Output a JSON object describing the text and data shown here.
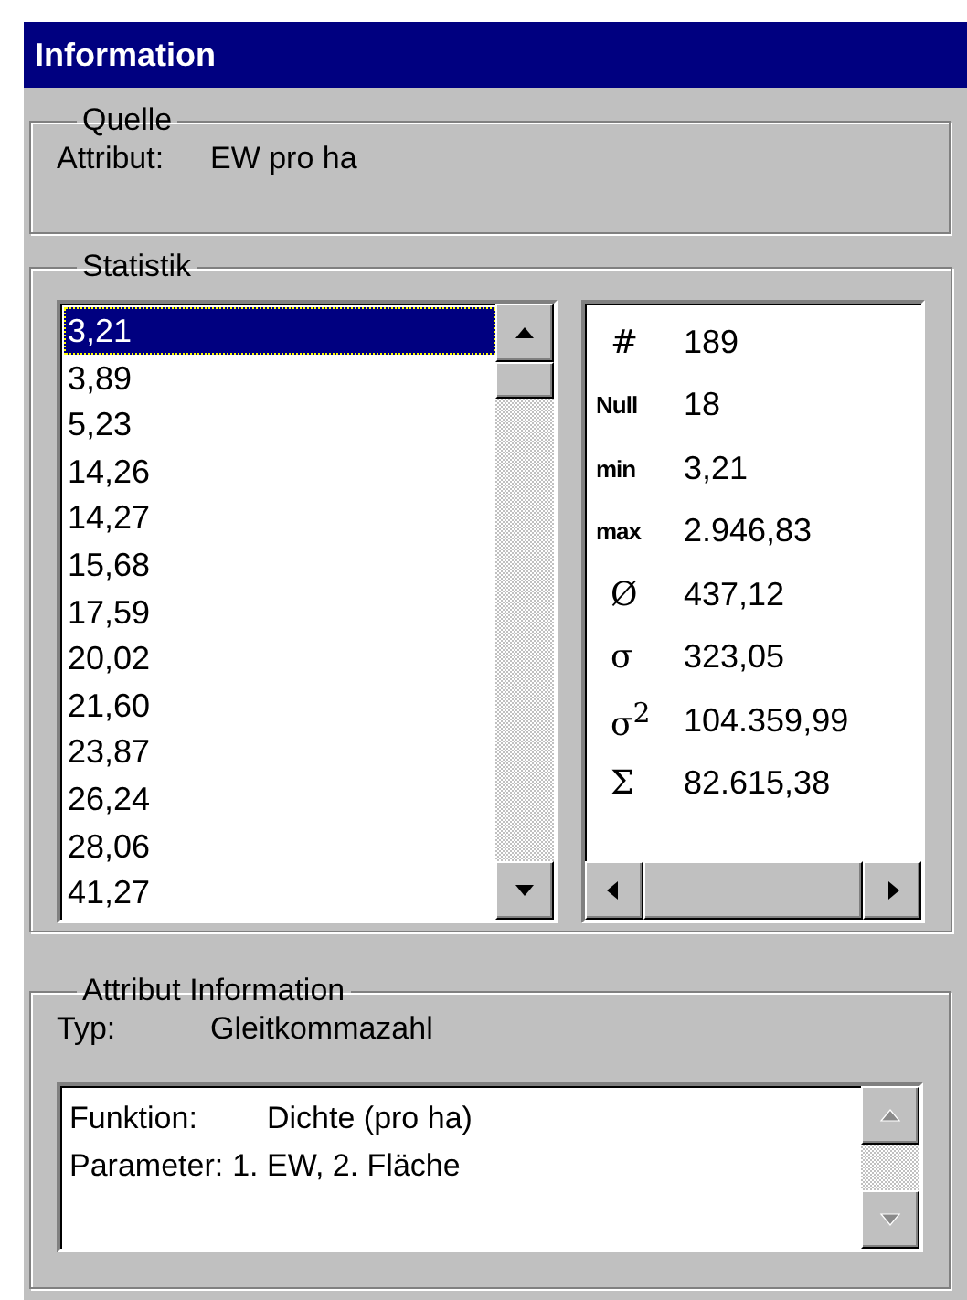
{
  "window": {
    "title": "Information"
  },
  "quelle": {
    "legend": "Quelle",
    "label": "Attribut:",
    "value": "EW pro ha"
  },
  "statistik": {
    "legend": "Statistik",
    "values": [
      {
        "text": "3,21",
        "selected": true
      },
      {
        "text": "3,89",
        "selected": false
      },
      {
        "text": "5,23",
        "selected": false
      },
      {
        "text": "14,26",
        "selected": false
      },
      {
        "text": "14,27",
        "selected": false
      },
      {
        "text": "15,68",
        "selected": false
      },
      {
        "text": "17,59",
        "selected": false
      },
      {
        "text": "20,02",
        "selected": false
      },
      {
        "text": "21,60",
        "selected": false
      },
      {
        "text": "23,87",
        "selected": false
      },
      {
        "text": "26,24",
        "selected": false
      },
      {
        "text": "28,06",
        "selected": false
      },
      {
        "text": "41,27",
        "selected": false
      }
    ],
    "measures": [
      {
        "symbol": "#",
        "kind": "symbol",
        "value": "189"
      },
      {
        "symbol": "Null",
        "kind": "word",
        "value": "18"
      },
      {
        "symbol": "min",
        "kind": "word",
        "value": "3,21"
      },
      {
        "symbol": "max",
        "kind": "word",
        "value": "2.946,83"
      },
      {
        "symbol": "Ø",
        "kind": "symbol",
        "value": "437,12"
      },
      {
        "symbol": "σ",
        "kind": "symbol",
        "value": "323,05"
      },
      {
        "symbol": "σ$^{2}$",
        "kind": "symbol",
        "value": "104.359,99"
      },
      {
        "symbol": "Σ",
        "kind": "symbol",
        "value": "82.615,38"
      }
    ]
  },
  "attribut_information": {
    "legend": "Attribut Information",
    "label": "Typ:",
    "value": "Gleitkommazahl",
    "details": {
      "scrollbar_disabled": true,
      "lines": [
        {
          "label": "Funktion:",
          "value": "Dichte (pro ha)"
        },
        {
          "label": "Parameter:",
          "value": "1. EW, 2. Fläche"
        }
      ]
    }
  }
}
